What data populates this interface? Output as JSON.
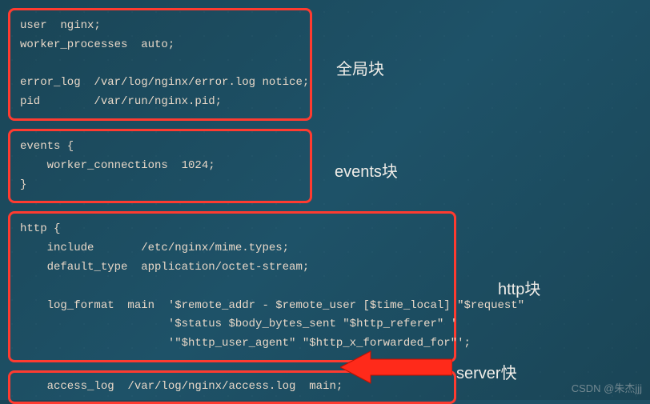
{
  "blocks": {
    "global": {
      "label": "全局块",
      "code": "user  nginx;\nworker_processes  auto;\n\nerror_log  /var/log/nginx/error.log notice;\npid        /var/run/nginx.pid;"
    },
    "events": {
      "label": "events块",
      "code": "events {\n    worker_connections  1024;\n}"
    },
    "http": {
      "label": "http块",
      "code": "http {\n    include       /etc/nginx/mime.types;\n    default_type  application/octet-stream;\n\n    log_format  main  '$remote_addr - $remote_user [$time_local] \"$request\"\n                      '$status $body_bytes_sent \"$http_referer\" '\n                      '\"$http_user_agent\" \"$http_x_forwarded_for\"';"
    },
    "server": {
      "label": "server快",
      "code": "    access_log  /var/log/nginx/access.log  main;"
    }
  },
  "watermark": "CSDN @朱杰jjj"
}
